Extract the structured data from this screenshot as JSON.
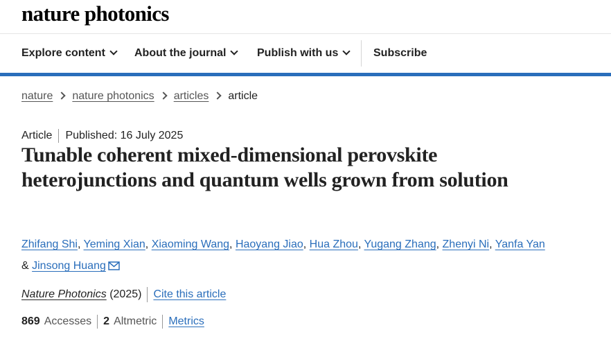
{
  "site": {
    "logo": "nature photonics"
  },
  "nav": {
    "items": [
      {
        "label": "Explore content"
      },
      {
        "label": "About the journal"
      },
      {
        "label": "Publish with us"
      }
    ],
    "subscribe": "Subscribe"
  },
  "breadcrumb": [
    "nature",
    "nature photonics",
    "articles",
    "article"
  ],
  "article": {
    "type": "Article",
    "published": "Published: 16 July 2025",
    "title": "Tunable coherent mixed-dimensional perovskite heterojunctions and quantum wells grown from solution",
    "authors": [
      "Zhifang Shi",
      "Yeming Xian",
      "Xiaoming Wang",
      "Haoyang Jiao",
      "Hua Zhou",
      "Yugang Zhang",
      "Zhenyi Ni",
      "Yanfa Yan"
    ],
    "last_author_prefix": "&",
    "last_author": "Jinsong Huang",
    "journal": "Nature Photonics",
    "year": "(2025)",
    "cite": "Cite this article"
  },
  "metrics": {
    "accesses_count": "869",
    "accesses_label": "Accesses",
    "altmetric_count": "2",
    "altmetric_label": "Altmetric",
    "link": "Metrics"
  },
  "colors": {
    "link": "#2a6ebb",
    "accent_rule": "#2a6ebb"
  },
  "icons": {
    "nav_dropdown": "chevron-down-icon",
    "breadcrumb_separator": "chevron-right-icon",
    "corresponding_author": "mail-icon"
  }
}
